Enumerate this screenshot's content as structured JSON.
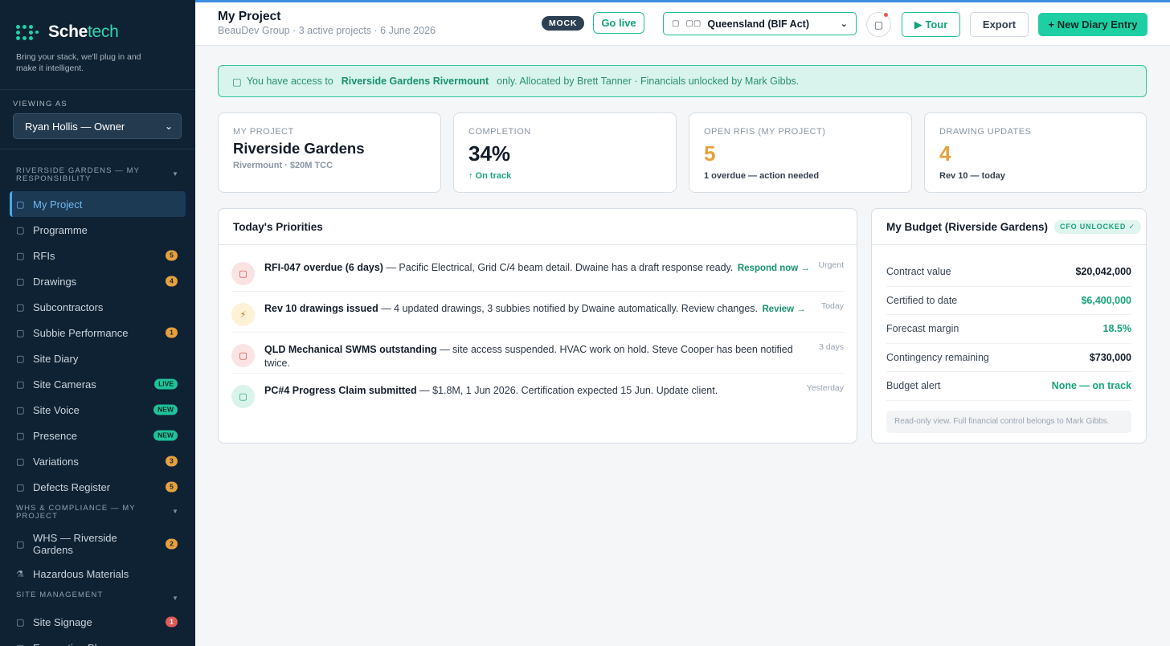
{
  "brand": {
    "name_a": "Sche",
    "name_b": "tech",
    "tagline": "Bring your stack, we'll plug in and make it intelligent."
  },
  "viewing": {
    "label": "VIEWING AS",
    "selected": "Ryan Hollis — Owner"
  },
  "sidebar": {
    "sections": [
      {
        "title": "RIVERSIDE GARDENS — MY RESPONSIBILITY",
        "items": [
          {
            "label": "My Project",
            "icon": "home-icon",
            "active": true
          },
          {
            "label": "Programme",
            "icon": "calendar-icon"
          },
          {
            "label": "RFIs",
            "icon": "question-icon",
            "badge": "5",
            "badge_color": "orange"
          },
          {
            "label": "Drawings",
            "icon": "drawing-icon",
            "badge": "4",
            "badge_color": "orange"
          },
          {
            "label": "Subcontractors",
            "icon": "people-icon"
          },
          {
            "label": "Subbie Performance",
            "icon": "chart-icon",
            "badge": "1",
            "badge_color": "orange"
          },
          {
            "label": "Site Diary",
            "icon": "diary-icon"
          },
          {
            "label": "Site Cameras",
            "icon": "camera-icon",
            "badge": "LIVE",
            "badge_color": "green"
          },
          {
            "label": "Site Voice",
            "icon": "mic-icon",
            "badge": "NEW",
            "badge_color": "green"
          },
          {
            "label": "Presence",
            "icon": "presence-icon",
            "badge": "NEW",
            "badge_color": "green"
          },
          {
            "label": "Variations",
            "icon": "variation-icon",
            "badge": "3",
            "badge_color": "orange"
          },
          {
            "label": "Defects Register",
            "icon": "defect-icon",
            "badge": "5",
            "badge_color": "orange"
          }
        ]
      },
      {
        "title": "WHS & COMPLIANCE — MY PROJECT",
        "items": [
          {
            "label": "WHS — Riverside Gardens",
            "icon": "shield-icon",
            "badge": "2",
            "badge_color": "orange"
          },
          {
            "label": "Hazardous Materials",
            "icon": "flask-icon"
          }
        ]
      },
      {
        "title": "SITE MANAGEMENT",
        "items": [
          {
            "label": "Site Signage",
            "icon": "sign-icon",
            "badge": "1",
            "badge_color": "red"
          },
          {
            "label": "Evacuation Plans",
            "icon": "map-icon"
          }
        ]
      }
    ]
  },
  "header": {
    "title": "My Project",
    "subtitle": "BeauDev Group · 3 active projects · 6 June 2026",
    "mock": "MOCK",
    "go_live": "Go live",
    "region": "Queensland (BIF Act)",
    "tour": "▶ Tour",
    "export": "Export",
    "new_entry": "+ New Diary Entry"
  },
  "alert": {
    "prefix": "You have access to",
    "project": "Riverside Gardens Rivermount",
    "suffix": "only. Allocated by Brett Tanner · Financials unlocked by Mark Gibbs."
  },
  "stats": [
    {
      "label": "MY PROJECT",
      "value": "Riverside Gardens",
      "sub": "Rivermount · $20M TCC"
    },
    {
      "label": "COMPLETION",
      "value": "34%",
      "sub": "↑ On track"
    },
    {
      "label": "OPEN RFIS (MY PROJECT)",
      "value": "5",
      "sub": "1 overdue — action needed"
    },
    {
      "label": "DRAWING UPDATES",
      "value": "4",
      "sub": "Rev 10 — today"
    }
  ],
  "priorities": {
    "title": "Today's Priorities",
    "items": [
      {
        "title": "RFI-047 overdue (6 days)",
        "text": " — Pacific Electrical, Grid C/4 beam detail. Dwaine has a draft response ready.",
        "action": "Respond now →",
        "time": "Urgent",
        "icon": "alert-icon",
        "tone": "red"
      },
      {
        "title": "Rev 10 drawings issued",
        "text": " — 4 updated drawings, 3 subbies notified by Dwaine automatically. Review changes.",
        "action": "Review →",
        "time": "Today",
        "icon": "lightning-icon",
        "tone": "yel"
      },
      {
        "title": "QLD Mechanical SWMS outstanding",
        "text": " — site access suspended. HVAC work on hold. Steve Cooper has been notified twice.",
        "action": "",
        "time": "3 days",
        "icon": "stop-icon",
        "tone": "red"
      },
      {
        "title": "PC#4 Progress Claim submitted",
        "text": " — $1.8M, 1 Jun 2026. Certification expected 15 Jun. Update client.",
        "action": "",
        "time": "Yesterday",
        "icon": "money-icon",
        "tone": "teal"
      }
    ]
  },
  "budget": {
    "title": "My Budget (Riverside Gardens)",
    "badge": "CFO UNLOCKED ✓",
    "rows": [
      {
        "label": "Contract value",
        "value": "$20,042,000",
        "tone": ""
      },
      {
        "label": "Certified to date",
        "value": "$6,400,000",
        "tone": "green"
      },
      {
        "label": "Forecast margin",
        "value": "18.5%",
        "tone": "green"
      },
      {
        "label": "Contingency remaining",
        "value": "$730,000",
        "tone": ""
      },
      {
        "label": "Budget alert",
        "value": "None — on track",
        "tone": "green"
      }
    ],
    "note": "Read-only view. Full financial control belongs to Mark Gibbs."
  }
}
